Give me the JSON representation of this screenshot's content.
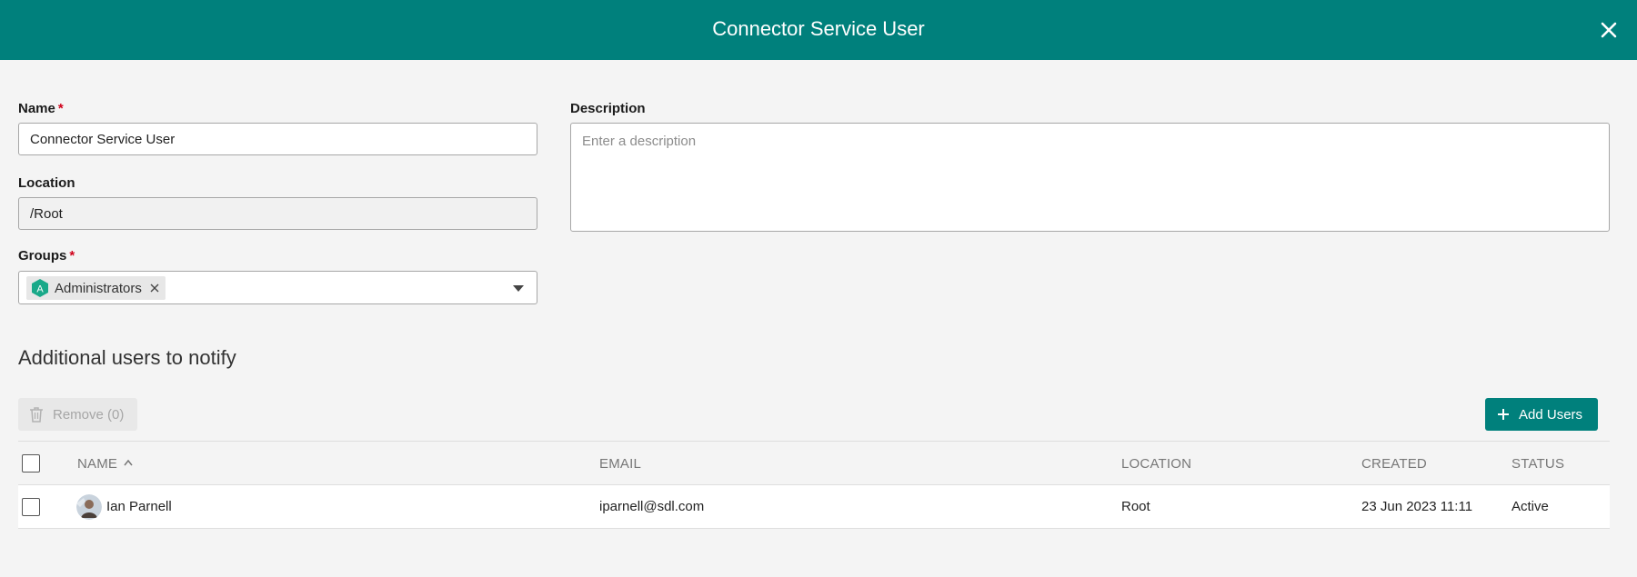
{
  "header": {
    "title": "Connector Service User",
    "close_icon": "close-icon"
  },
  "form": {
    "name": {
      "label": "Name",
      "required_mark": "*",
      "value": "Connector Service User"
    },
    "location": {
      "label": "Location",
      "value": "/Root"
    },
    "groups": {
      "label": "Groups",
      "required_mark": "*",
      "chips": [
        {
          "badge": "A",
          "label": "Administrators"
        }
      ]
    },
    "description": {
      "label": "Description",
      "placeholder": "Enter a description"
    }
  },
  "notify": {
    "title": "Additional users to notify",
    "remove_label": "Remove (0)",
    "add_label": "Add Users",
    "columns": {
      "name": "NAME",
      "email": "EMAIL",
      "location": "LOCATION",
      "created": "CREATED",
      "status": "STATUS"
    },
    "rows": [
      {
        "name": "Ian Parnell",
        "email": "iparnell@sdl.com",
        "location": "Root",
        "created": "23 Jun 2023 11:11",
        "status": "Active"
      }
    ]
  },
  "colors": {
    "accent": "#00807c",
    "required": "#d0021b",
    "chip_badge": "#19a989"
  }
}
